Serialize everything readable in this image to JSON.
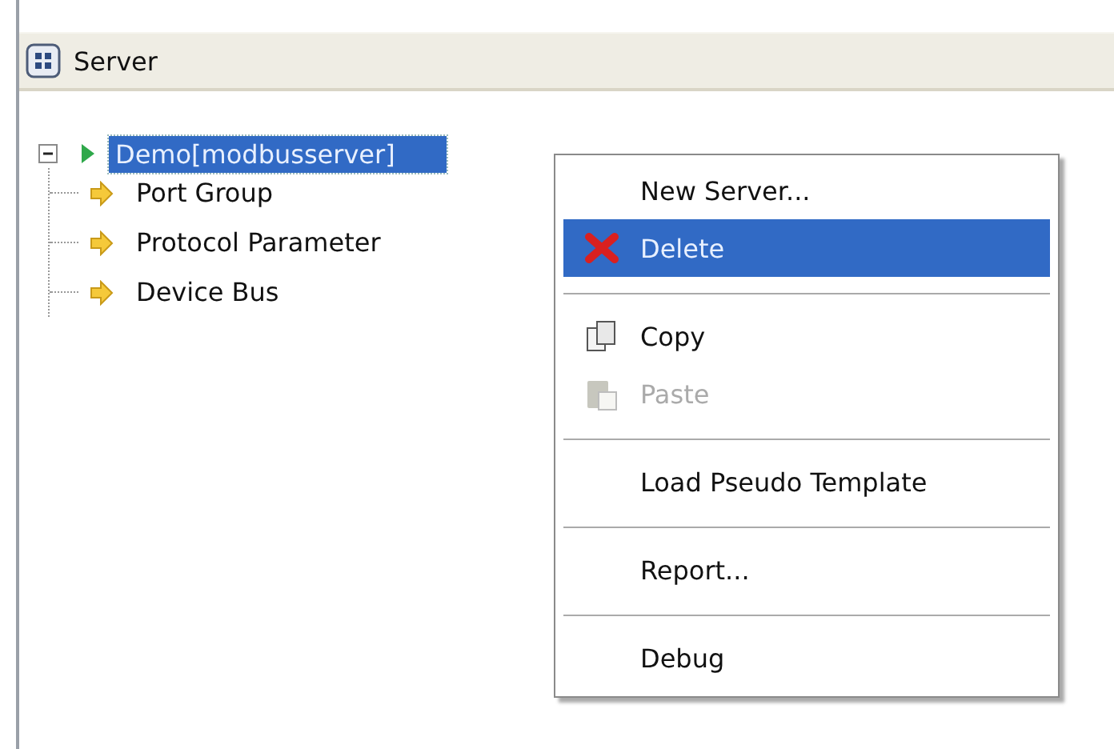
{
  "panel": {
    "title": "Server"
  },
  "tree": [
    {
      "label": "Demo[modbusserver]",
      "selected": true,
      "expanded": true,
      "children": [
        {
          "label": "Port Group",
          "selected": false
        },
        {
          "label": "Protocol Parameter",
          "selected": false
        },
        {
          "label": "Device Bus",
          "selected": false
        }
      ]
    }
  ],
  "context_menu": [
    {
      "kind": "item",
      "label": "New Server...",
      "selected": false,
      "disabled": false
    },
    {
      "kind": "delete",
      "label": "Delete",
      "selected": true,
      "disabled": false
    },
    {
      "kind": "separator"
    },
    {
      "kind": "copy",
      "label": "Copy",
      "selected": false,
      "disabled": false
    },
    {
      "kind": "paste",
      "label": "Paste",
      "selected": false,
      "disabled": true
    },
    {
      "kind": "separator"
    },
    {
      "kind": "item",
      "label": "Load Pseudo Template",
      "selected": false,
      "disabled": false
    },
    {
      "kind": "separator"
    },
    {
      "kind": "item",
      "label": "Report...",
      "selected": false,
      "disabled": false
    },
    {
      "kind": "separator"
    },
    {
      "kind": "item",
      "label": "Debug",
      "selected": false,
      "disabled": false
    }
  ]
}
